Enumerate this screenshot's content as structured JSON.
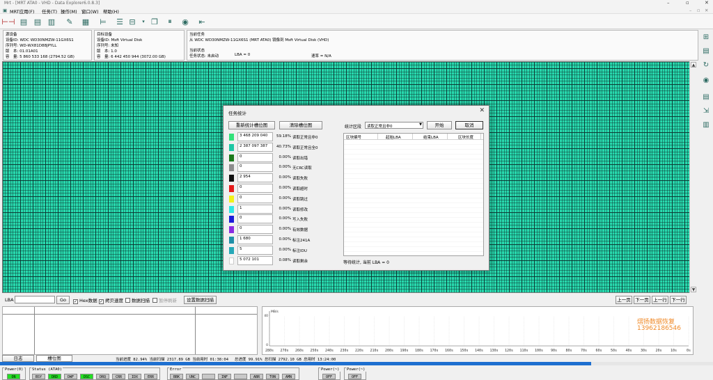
{
  "window": {
    "title": "Mrt - [MRT ATA0 - VHD - Data Explorer6.0.8.3]",
    "controls": [
      "–",
      "▫",
      "✕"
    ],
    "doc_controls": [
      "–",
      "▫",
      "✕"
    ]
  },
  "menu": [
    "MRT应用(F)",
    "任务(T)",
    "操作(M)",
    "窗口(W)",
    "帮助(H)"
  ],
  "toolbar_icons": [
    "split-icon",
    "doc-icon",
    "doc-icon",
    "doc-icon",
    "edit-icon",
    "save-icon",
    "link-icon",
    "list-icon",
    "dropdown-icon",
    "copy-icon",
    "pause-icon",
    "stop-icon",
    "exit-icon"
  ],
  "source": {
    "header": "源设备",
    "id": "设备ID: WDC WD30NMZW-11GX6S1",
    "serial": "序列号: WD-WX81D88JPYLL",
    "version": "版　本: 01.01A01",
    "capacity": "容　量: 5 860 533 168 (2794.52 GB)"
  },
  "target": {
    "header": "目标设备",
    "id": "设备ID: Msft Virtual Disk",
    "serial": "序列号: 未知",
    "version": "版　本: 1.0",
    "capacity": "容　量: 6 442 450 944 (3072.00 GB)"
  },
  "task": {
    "header": "当前任务",
    "desc": "从 WDC WD30NMZW-11GX6S1 (MRT ATA0) 镜像到 Msft Virtual Disk (VHD)",
    "state_header": "当前状态",
    "state": "任务状态: 未启动",
    "lba": "LBA = 0",
    "rate": "速率 = N/A"
  },
  "lba_row": {
    "label": "LBA",
    "go": "Go",
    "hex": "Hex数据",
    "copy_speed": "拷贝速度",
    "scan": "数据扫描",
    "pause_scan": "暂停刷新",
    "scan_settings": "设置数据扫描",
    "prev_page": "上一页",
    "next_page": "下一页",
    "prev_row": "上一行",
    "next_row": "下一行"
  },
  "dialog": {
    "title": "任务统计",
    "redraw": "重新统计槽位图",
    "clear": "清除槽位图",
    "range_label": "统计区段",
    "range_value": "读取正常且非0",
    "start": "开始",
    "cancel": "取消",
    "columns": [
      "区块编号",
      "起始LBA",
      "结束LBA",
      "区块长度"
    ],
    "waiting": "等待统计, 当前 LBA = 0",
    "stats": [
      {
        "color": "#33e27a",
        "value": "3 468 209 040",
        "pct": "59.18%",
        "name": "读取正常且非0"
      },
      {
        "color": "#1ec7a4",
        "value": "2 387 097 387",
        "pct": "40.73%",
        "name": "读取正常且全0"
      },
      {
        "color": "#1b7a1b",
        "value": "0",
        "pct": "0.00%",
        "name": "读取出错"
      },
      {
        "color": "#8c8c8c",
        "value": "0",
        "pct": "0.00%",
        "name": "无CRC读取"
      },
      {
        "color": "#111111",
        "value": "2 954",
        "pct": "0.00%",
        "name": "读取失败"
      },
      {
        "color": "#e51a1a",
        "value": "0",
        "pct": "0.00%",
        "name": "读取超时"
      },
      {
        "color": "#f2f21a",
        "value": "0",
        "pct": "0.00%",
        "name": "读取跳过"
      },
      {
        "color": "#2fe5e5",
        "value": "1",
        "pct": "0.00%",
        "name": "读取修改"
      },
      {
        "color": "#1a1ad9",
        "value": "0",
        "pct": "0.00%",
        "name": "写入失败"
      },
      {
        "color": "#8a2be2",
        "value": "0",
        "pct": "0.00%",
        "name": "有效数据"
      },
      {
        "color": "#1f8fa8",
        "value": "1 680",
        "pct": "0.00%",
        "name": "标注241A"
      },
      {
        "color": "#26a8b8",
        "value": "5",
        "pct": "0.00%",
        "name": "标注IDU"
      },
      {
        "color": "#ffffff",
        "value": "5 072 101",
        "pct": "0.08%",
        "name": "读取剩余"
      }
    ]
  },
  "rate_chart": {
    "y_labels": [
      "40",
      "0"
    ],
    "y_unit": "MB/s",
    "x_ticks": [
      "280s",
      "270s",
      "260s",
      "250s",
      "240s",
      "230s",
      "220s",
      "210s",
      "200s",
      "190s",
      "180s",
      "170s",
      "160s",
      "150s",
      "140s",
      "130s",
      "120s",
      "110s",
      "100s",
      "90s",
      "80s",
      "70s",
      "60s",
      "50s",
      "40s",
      "30s",
      "20s",
      "10s",
      "0s"
    ]
  },
  "watermark": {
    "line1": "熠扬数据恢复",
    "line2": "13962186546"
  },
  "bottom": {
    "tab_log": "日志",
    "tab_map": "槽位图",
    "progress_text": "当前进度 82.94% 当前扫描 2317.89 GB 当前用时 01:38:04 　总进度 99.91% 总扫描 2792.10 GB 总用时 13:24:00",
    "progress_pct": 82.94
  },
  "status": {
    "power_label": "Power(0)",
    "power_led": "ON",
    "status_label": "Status (ATA0)",
    "status_leds": [
      "BSY",
      "DRD",
      "DWF",
      "DSC",
      "DRQ",
      "CRR",
      "IDX",
      "ERR"
    ],
    "status_on": [
      "DRD",
      "DSC"
    ],
    "error_label": "Error",
    "error_leds": [
      "BBK",
      "UNC",
      "",
      "INF",
      "",
      "ABR",
      "T0N",
      "AMN"
    ],
    "power2_label": "Power(~)",
    "power2_led": "OFF",
    "power3_label": "Power(~)",
    "power3_led": "OFF"
  }
}
